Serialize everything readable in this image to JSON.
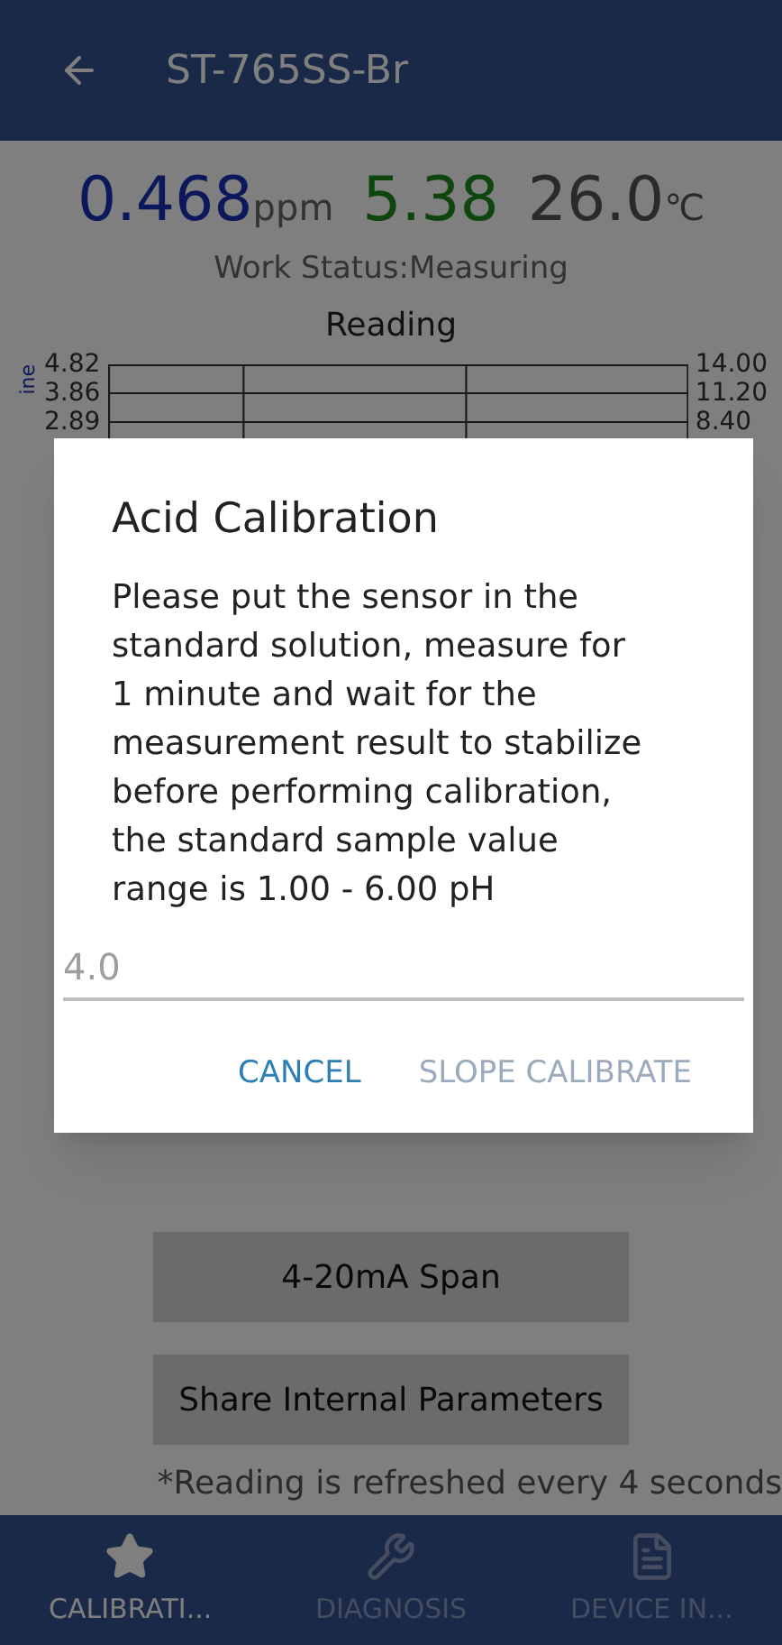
{
  "app_bar": {
    "title": "ST-765SS-Br"
  },
  "readings": [
    {
      "kind": "primary",
      "value": "0.468",
      "unit": "ppm"
    },
    {
      "kind": "ph",
      "value": "5.38"
    },
    {
      "kind": "temp",
      "value": "26.0",
      "unit": "℃"
    }
  ],
  "work_status": "Work Status:Measuring",
  "chart": {
    "title": "Reading",
    "left_axis_label": "ine",
    "left_ticks": [
      "4.82",
      "3.86",
      "2.89"
    ],
    "right_ticks": [
      "14.00",
      "11.20",
      "8.40"
    ]
  },
  "buttons": [
    "4-20mA Span",
    "Share Internal Parameters"
  ],
  "footnote": "*Reading is refreshed every 4 seconds",
  "bottom_nav": [
    {
      "label": "CALIBRATI...",
      "kind": "star",
      "selected": true
    },
    {
      "label": "DIAGNOSIS",
      "kind": "tools",
      "selected": false
    },
    {
      "label": "DEVICE IN...",
      "kind": "document",
      "selected": false
    }
  ],
  "dialog": {
    "title": "Acid Calibration",
    "message": "Please put the sensor in the standard solution, measure for 1 minute and wait for the measurement result to stabilize before performing calibration, the standard sample value range is 1.00 - 6.00 pH",
    "input": {
      "placeholder": "4.0"
    },
    "actions": [
      {
        "label": "CANCEL",
        "disabled": false
      },
      {
        "label": "SLOPE CALIBRATE",
        "disabled": true
      }
    ]
  }
}
